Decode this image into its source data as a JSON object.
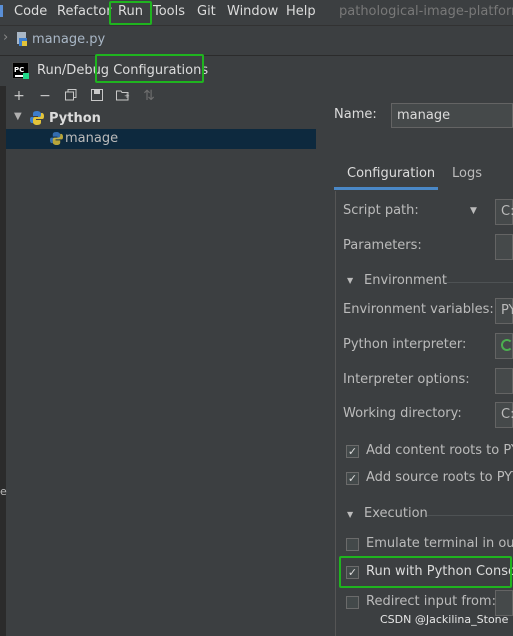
{
  "menu": {
    "items": [
      "Code",
      "Refactor",
      "Run",
      "Tools",
      "Git",
      "Window",
      "Help"
    ],
    "project_title": "pathological-image-platform"
  },
  "navbar": {
    "file_label": "manage.py"
  },
  "dialog": {
    "title": "Run/Debug Configurations"
  },
  "tree": {
    "group_label": "Python",
    "item_label": "manage"
  },
  "form": {
    "name_label": "Name:",
    "name_value": "manage",
    "tabs": [
      "Configuration",
      "Logs"
    ],
    "script_path_label": "Script path:",
    "script_path_value": "C:",
    "parameters_label": "Parameters:",
    "environment_section": "Environment",
    "env_vars_label": "Environment variables:",
    "env_vars_value": "PY",
    "interpreter_label": "Python interpreter:",
    "interpreter_options_label": "Interpreter options:",
    "working_dir_label": "Working directory:",
    "working_dir_value": "C:",
    "add_content_roots": "Add content roots to PYTH",
    "add_source_roots": "Add source roots to PYTH",
    "execution_section": "Execution",
    "emulate_terminal": "Emulate terminal in outpu",
    "run_with_console": "Run with Python Console",
    "redirect_input": "Redirect input from:"
  },
  "watermark": "CSDN @Jackilina_Stone",
  "colors": {
    "highlight": "#1fb41f",
    "selection": "#0d293e",
    "accent": "#4a88c7"
  }
}
